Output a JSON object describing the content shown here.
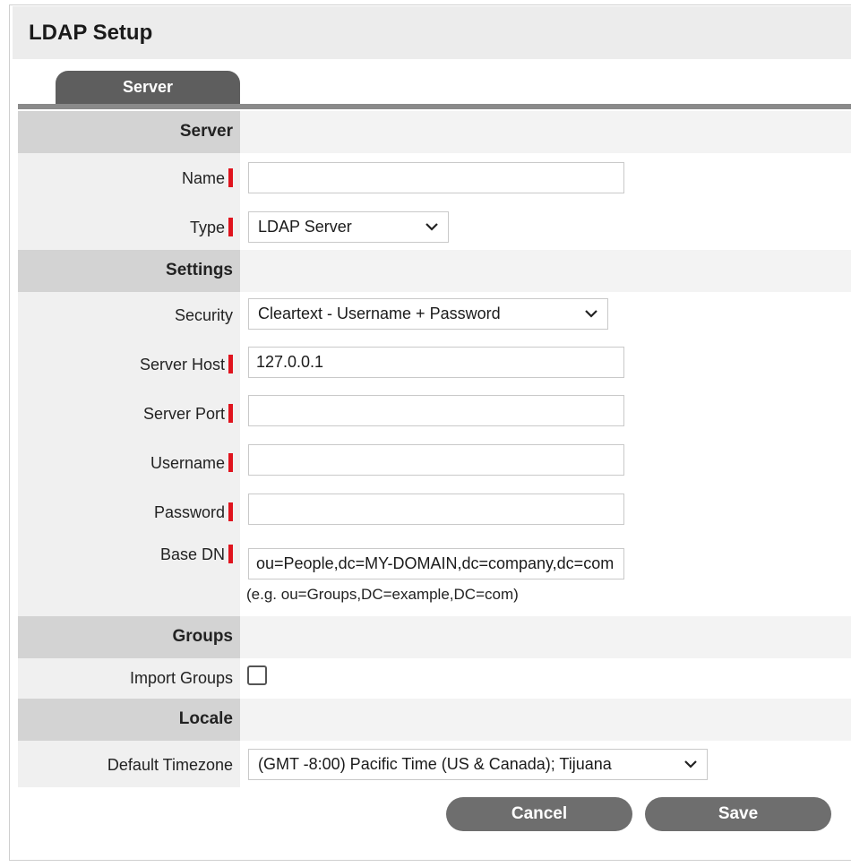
{
  "header": {
    "title": "LDAP Setup"
  },
  "tabs": [
    {
      "label": "Server"
    }
  ],
  "sections": {
    "server": "Server",
    "settings": "Settings",
    "groups": "Groups",
    "locale": "Locale"
  },
  "fields": {
    "name": {
      "label": "Name",
      "value": ""
    },
    "type": {
      "label": "Type",
      "value": "LDAP Server"
    },
    "security": {
      "label": "Security",
      "value": "Cleartext - Username + Password"
    },
    "server_host": {
      "label": "Server Host",
      "value": "127.0.0.1"
    },
    "server_port": {
      "label": "Server Port",
      "value": ""
    },
    "username": {
      "label": "Username",
      "value": ""
    },
    "password": {
      "label": "Password",
      "value": ""
    },
    "base_dn": {
      "label": "Base DN",
      "value": "ou=People,dc=MY-DOMAIN,dc=company,dc=com",
      "hint": "(e.g. ou=Groups,DC=example,DC=com)"
    },
    "import_groups": {
      "label": "Import Groups",
      "checked": false
    },
    "default_timezone": {
      "label": "Default Timezone",
      "value": "(GMT -8:00) Pacific Time (US & Canada); Tijuana"
    }
  },
  "buttons": {
    "cancel": "Cancel",
    "save": "Save"
  },
  "colors": {
    "required_marker": "#e0141e",
    "tab": "#5e5e5e",
    "button": "#6e6e6e"
  }
}
